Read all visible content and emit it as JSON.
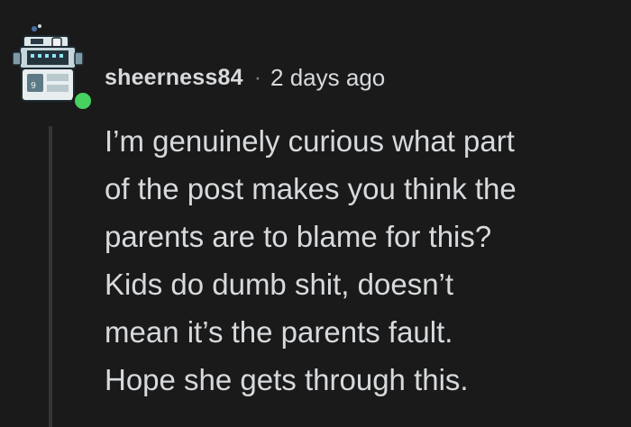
{
  "comment": {
    "author": "sheerness84",
    "separator": "·",
    "timestamp": "2 days ago",
    "avatar_icon": "robot-avatar-icon",
    "status": "online",
    "status_color": "#46d160",
    "lines": [
      "I’m genuinely curious what part",
      "of the post makes you think the",
      "parents are to blame for this?",
      "Kids do dumb shit, doesn’t",
      "mean it’s the parents fault.",
      "Hope she gets through this."
    ]
  },
  "colors": {
    "background": "#1a1a1b",
    "text": "#d7dadc",
    "muted": "#818384",
    "thread_line": "#343536"
  }
}
